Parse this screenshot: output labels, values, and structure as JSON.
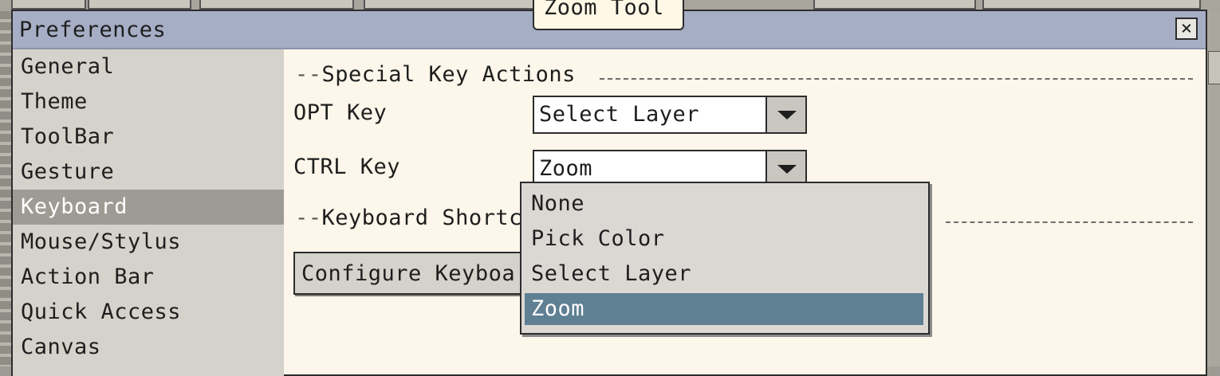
{
  "window": {
    "title": "Preferences"
  },
  "tooltip": "Zoom Tool",
  "sidebar": {
    "items": [
      {
        "label": "General"
      },
      {
        "label": "Theme"
      },
      {
        "label": "ToolBar"
      },
      {
        "label": "Gesture"
      },
      {
        "label": "Keyboard",
        "selected": true
      },
      {
        "label": "Mouse/Stylus"
      },
      {
        "label": "Action Bar"
      },
      {
        "label": "Quick Access"
      },
      {
        "label": "Canvas"
      }
    ]
  },
  "special_keys": {
    "heading": "Special Key Actions",
    "opt_label": "OPT Key",
    "opt_value": "Select Layer",
    "ctrl_label": "CTRL Key",
    "ctrl_value": "Zoom"
  },
  "shortcuts": {
    "heading": "Keyboard Shortc",
    "button_label": "Configure Keyboa"
  },
  "dropdown": {
    "options": [
      "None",
      "Pick Color",
      "Select Layer",
      "Zoom"
    ],
    "selected": "Zoom"
  },
  "colors": {
    "titlebar": "#a6aec5",
    "selection": "#5f7f93",
    "sidebar_active": "#9d9b93"
  }
}
